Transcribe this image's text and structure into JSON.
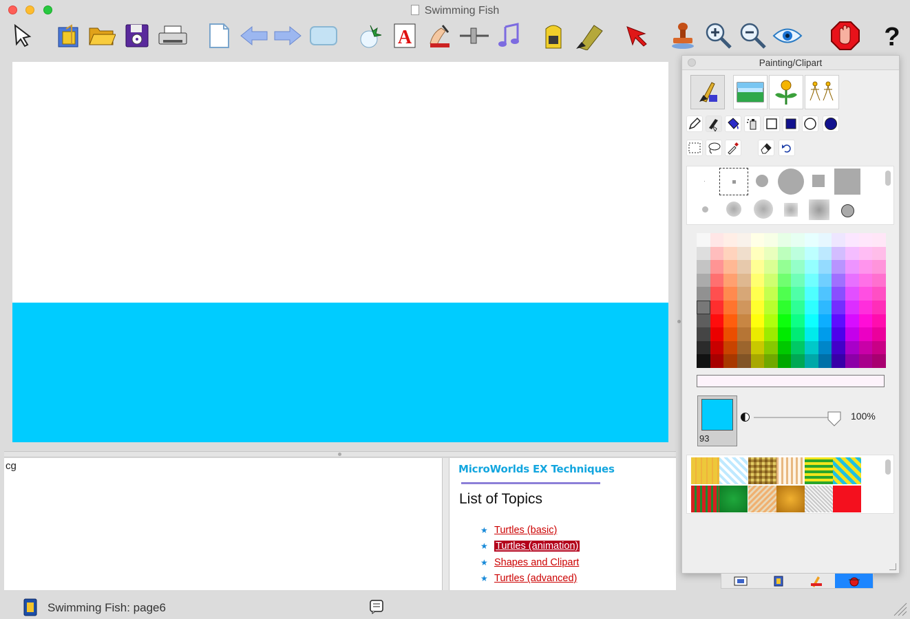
{
  "window": {
    "title": "Swimming Fish"
  },
  "toolbar": {
    "tools": [
      "pointer-icon",
      "gift-project-icon",
      "open-folder-icon",
      "save-disk-icon",
      "print-icon",
      "new-page-icon",
      "back-arrow-icon",
      "forward-arrow-icon",
      "button-shape-icon",
      "turtle-icon",
      "text-box-icon",
      "hand-pen-icon",
      "slider-icon",
      "music-note-icon",
      "backpack-icon",
      "paint-brush-icon",
      "arrow-cursor-icon",
      "stamp-icon",
      "zoom-in-icon",
      "zoom-out-icon",
      "eye-icon",
      "stop-hand-icon",
      "help-icon"
    ]
  },
  "command_center": {
    "text": "cg"
  },
  "help": {
    "brand": "MicroWorlds EX Techniques",
    "title": "List of Topics",
    "topics": [
      {
        "label": "Turtles (basic)",
        "selected": false
      },
      {
        "label": "Turtles (animation)",
        "selected": true
      },
      {
        "label": "Shapes and Clipart",
        "selected": false
      },
      {
        "label": "Turtles (advanced)",
        "selected": false
      },
      {
        "label": "",
        "selected": false
      }
    ]
  },
  "panel": {
    "title": "Painting/Clipart",
    "modes": [
      "painting-tools-icon",
      "backgrounds-icon",
      "single-shape-icon",
      "animated-shapes-icon"
    ],
    "active_mode": 0,
    "paint_tools": [
      "pencil-icon",
      "brush-icon",
      "paint-bucket-icon",
      "spray-can-icon",
      "rectangle-outline-icon",
      "rectangle-filled-icon",
      "ellipse-outline-icon",
      "ellipse-filled-icon"
    ],
    "select_tools": [
      "rect-select-icon",
      "lasso-icon",
      "eyedropper-icon",
      "eraser-icon",
      "undo-icon"
    ],
    "current_color": {
      "number": "93",
      "hex": "#00ccff"
    },
    "opacity": "100%",
    "opacity_value": 1.0
  },
  "status": {
    "text": "Swimming Fish:  page6"
  },
  "colors": {
    "water": "#00ccff",
    "link": "#cc0000",
    "link_selected_bg": "#b3001b",
    "brand": "#13a6df"
  }
}
